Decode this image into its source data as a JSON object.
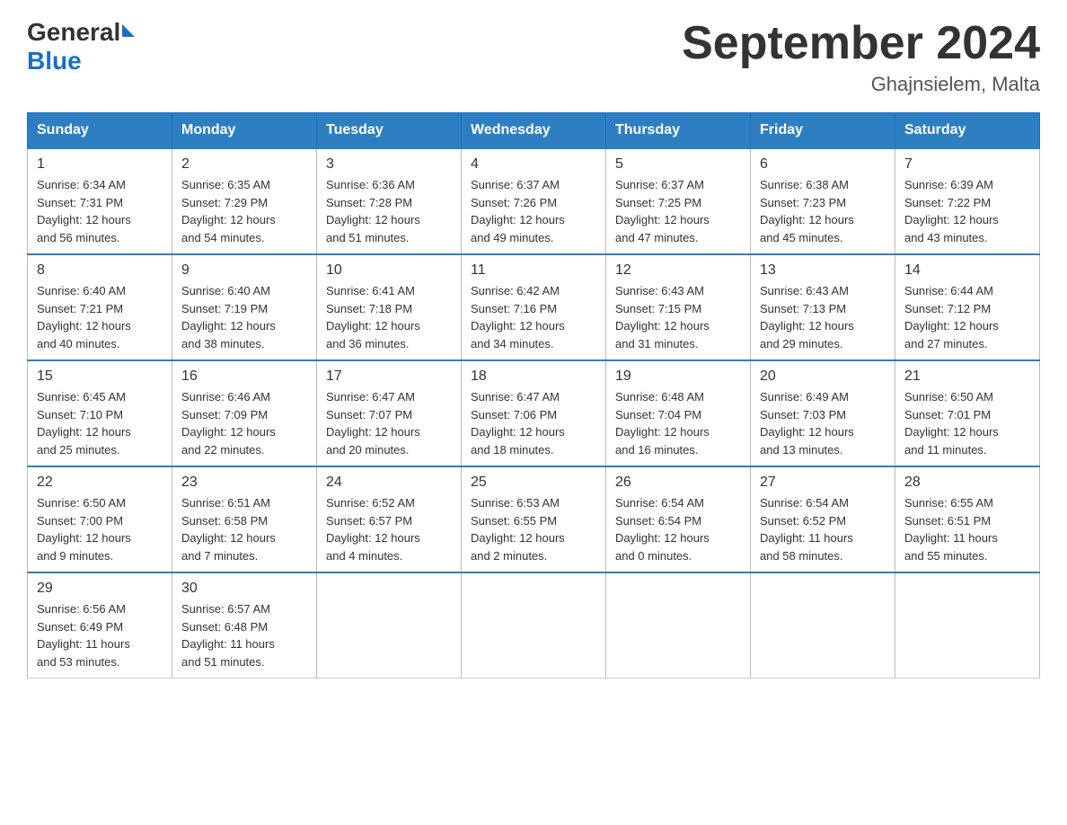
{
  "header": {
    "logo_general": "General",
    "logo_blue": "Blue",
    "month_title": "September 2024",
    "location": "Ghajnsielem, Malta"
  },
  "days_of_week": [
    "Sunday",
    "Monday",
    "Tuesday",
    "Wednesday",
    "Thursday",
    "Friday",
    "Saturday"
  ],
  "weeks": [
    [
      {
        "day": "1",
        "sunrise": "6:34 AM",
        "sunset": "7:31 PM",
        "daylight": "12 hours and 56 minutes."
      },
      {
        "day": "2",
        "sunrise": "6:35 AM",
        "sunset": "7:29 PM",
        "daylight": "12 hours and 54 minutes."
      },
      {
        "day": "3",
        "sunrise": "6:36 AM",
        "sunset": "7:28 PM",
        "daylight": "12 hours and 51 minutes."
      },
      {
        "day": "4",
        "sunrise": "6:37 AM",
        "sunset": "7:26 PM",
        "daylight": "12 hours and 49 minutes."
      },
      {
        "day": "5",
        "sunrise": "6:37 AM",
        "sunset": "7:25 PM",
        "daylight": "12 hours and 47 minutes."
      },
      {
        "day": "6",
        "sunrise": "6:38 AM",
        "sunset": "7:23 PM",
        "daylight": "12 hours and 45 minutes."
      },
      {
        "day": "7",
        "sunrise": "6:39 AM",
        "sunset": "7:22 PM",
        "daylight": "12 hours and 43 minutes."
      }
    ],
    [
      {
        "day": "8",
        "sunrise": "6:40 AM",
        "sunset": "7:21 PM",
        "daylight": "12 hours and 40 minutes."
      },
      {
        "day": "9",
        "sunrise": "6:40 AM",
        "sunset": "7:19 PM",
        "daylight": "12 hours and 38 minutes."
      },
      {
        "day": "10",
        "sunrise": "6:41 AM",
        "sunset": "7:18 PM",
        "daylight": "12 hours and 36 minutes."
      },
      {
        "day": "11",
        "sunrise": "6:42 AM",
        "sunset": "7:16 PM",
        "daylight": "12 hours and 34 minutes."
      },
      {
        "day": "12",
        "sunrise": "6:43 AM",
        "sunset": "7:15 PM",
        "daylight": "12 hours and 31 minutes."
      },
      {
        "day": "13",
        "sunrise": "6:43 AM",
        "sunset": "7:13 PM",
        "daylight": "12 hours and 29 minutes."
      },
      {
        "day": "14",
        "sunrise": "6:44 AM",
        "sunset": "7:12 PM",
        "daylight": "12 hours and 27 minutes."
      }
    ],
    [
      {
        "day": "15",
        "sunrise": "6:45 AM",
        "sunset": "7:10 PM",
        "daylight": "12 hours and 25 minutes."
      },
      {
        "day": "16",
        "sunrise": "6:46 AM",
        "sunset": "7:09 PM",
        "daylight": "12 hours and 22 minutes."
      },
      {
        "day": "17",
        "sunrise": "6:47 AM",
        "sunset": "7:07 PM",
        "daylight": "12 hours and 20 minutes."
      },
      {
        "day": "18",
        "sunrise": "6:47 AM",
        "sunset": "7:06 PM",
        "daylight": "12 hours and 18 minutes."
      },
      {
        "day": "19",
        "sunrise": "6:48 AM",
        "sunset": "7:04 PM",
        "daylight": "12 hours and 16 minutes."
      },
      {
        "day": "20",
        "sunrise": "6:49 AM",
        "sunset": "7:03 PM",
        "daylight": "12 hours and 13 minutes."
      },
      {
        "day": "21",
        "sunrise": "6:50 AM",
        "sunset": "7:01 PM",
        "daylight": "12 hours and 11 minutes."
      }
    ],
    [
      {
        "day": "22",
        "sunrise": "6:50 AM",
        "sunset": "7:00 PM",
        "daylight": "12 hours and 9 minutes."
      },
      {
        "day": "23",
        "sunrise": "6:51 AM",
        "sunset": "6:58 PM",
        "daylight": "12 hours and 7 minutes."
      },
      {
        "day": "24",
        "sunrise": "6:52 AM",
        "sunset": "6:57 PM",
        "daylight": "12 hours and 4 minutes."
      },
      {
        "day": "25",
        "sunrise": "6:53 AM",
        "sunset": "6:55 PM",
        "daylight": "12 hours and 2 minutes."
      },
      {
        "day": "26",
        "sunrise": "6:54 AM",
        "sunset": "6:54 PM",
        "daylight": "12 hours and 0 minutes."
      },
      {
        "day": "27",
        "sunrise": "6:54 AM",
        "sunset": "6:52 PM",
        "daylight": "11 hours and 58 minutes."
      },
      {
        "day": "28",
        "sunrise": "6:55 AM",
        "sunset": "6:51 PM",
        "daylight": "11 hours and 55 minutes."
      }
    ],
    [
      {
        "day": "29",
        "sunrise": "6:56 AM",
        "sunset": "6:49 PM",
        "daylight": "11 hours and 53 minutes."
      },
      {
        "day": "30",
        "sunrise": "6:57 AM",
        "sunset": "6:48 PM",
        "daylight": "11 hours and 51 minutes."
      },
      null,
      null,
      null,
      null,
      null
    ]
  ],
  "labels": {
    "sunrise": "Sunrise: ",
    "sunset": "Sunset: ",
    "daylight": "Daylight: "
  }
}
